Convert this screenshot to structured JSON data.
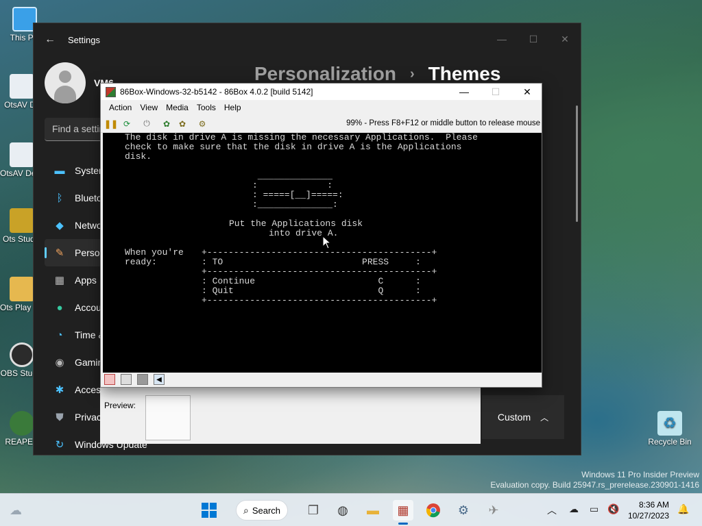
{
  "desktop": {
    "icons": [
      {
        "label": "This PC",
        "color": "#3aa0e8"
      },
      {
        "label": "OtsAV DJ",
        "color": "#e9eef3"
      },
      {
        "label": "OtsAV Demons...",
        "color": "#e9eef3"
      },
      {
        "label": "Ots Studio",
        "color": "#c9a227"
      },
      {
        "label": "Ots Play Templ...",
        "color": "#e6b84f"
      },
      {
        "label": "OBS Studio",
        "color": "#2b2b2b"
      },
      {
        "label": "REAPER",
        "color": "#3a7a3a"
      },
      {
        "label": "Recycle Bin",
        "color": "#bfe6ef"
      }
    ],
    "watermark": {
      "line1": "Windows 11 Pro Insider Preview",
      "line2": "Evaluation copy. Build 25947.rs_prerelease.230901-1416"
    }
  },
  "settings": {
    "title": "Settings",
    "user_name": "VM6",
    "search_placeholder": "Find a setting",
    "breadcrumb": {
      "parent": "Personalization",
      "current": "Themes"
    },
    "nav": [
      {
        "label": "System",
        "icon": "monitor-icon"
      },
      {
        "label": "Bluetooth & devices",
        "icon": "bluetooth-icon"
      },
      {
        "label": "Network & internet",
        "icon": "wifi-icon"
      },
      {
        "label": "Personalization",
        "icon": "brush-icon",
        "selected": true
      },
      {
        "label": "Apps",
        "icon": "apps-icon"
      },
      {
        "label": "Accounts",
        "icon": "person-icon"
      },
      {
        "label": "Time & language",
        "icon": "globe-clock-icon"
      },
      {
        "label": "Gaming",
        "icon": "gamepad-icon"
      },
      {
        "label": "Accessibility",
        "icon": "accessibility-icon"
      },
      {
        "label": "Privacy & security",
        "icon": "shield-icon"
      },
      {
        "label": "Windows Update",
        "icon": "update-icon"
      }
    ],
    "custom_dropdown": "Custom"
  },
  "theme_dialog": {
    "preview_label": "Preview:"
  },
  "box86": {
    "title": "86Box-Windows-32-b5142 - 86Box 4.0.2 [build 5142]",
    "menu": [
      "Action",
      "View",
      "Media",
      "Tools",
      "Help"
    ],
    "status": "99% - Press F8+F12 or middle button to release mouse",
    "screen_lines": [
      "The disk in drive A is missing the necessary Applications.  Please",
      "check to make sure that the disk in drive A is the Applications",
      "disk.",
      " ______________",
      ":             :",
      ": =====[__]=====:",
      ":______________:",
      "Put the Applications disk",
      "into drive A.",
      "When you're",
      "ready:",
      "+------------------------------------------+",
      ": TO                          PRESS     :",
      "+------------------------------------------+",
      ": Continue                       C      :",
      ": Quit                           Q      :",
      "+------------------------------------------+"
    ]
  },
  "taskbar": {
    "search_label": "Search",
    "time": "8:36 AM",
    "date": "10/27/2023"
  },
  "colors": {
    "accent": "#60cdff",
    "taskbar_accent": "#0067c0"
  }
}
